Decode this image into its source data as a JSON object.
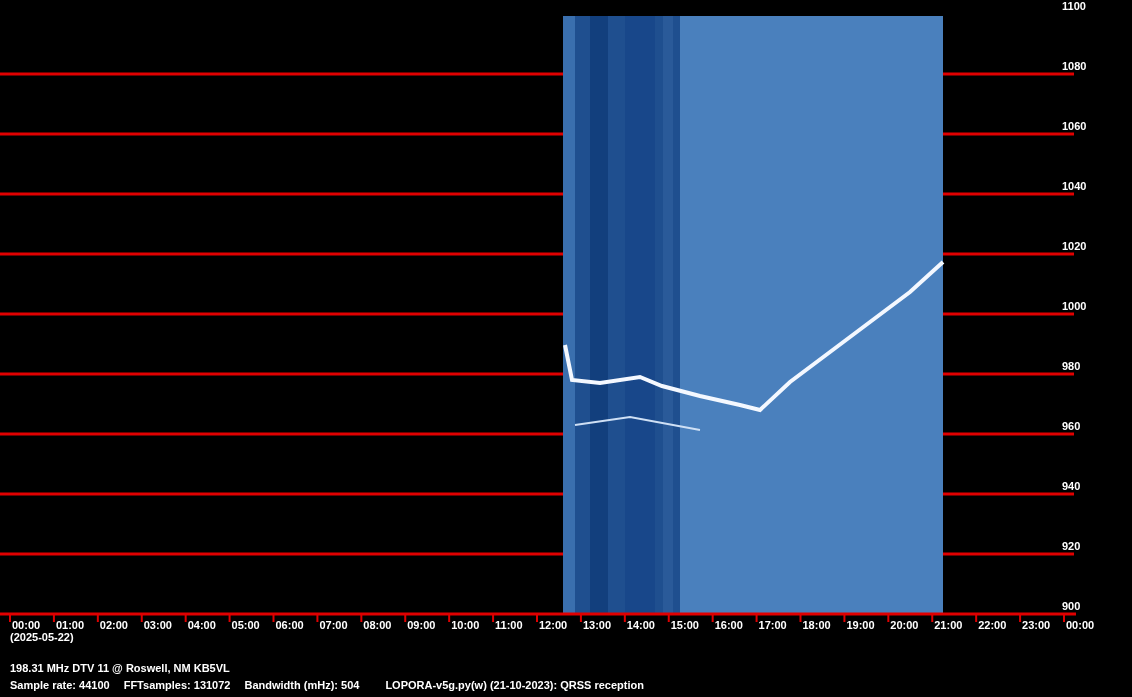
{
  "plot": {
    "y_axis_labels": [
      "1100",
      "1080",
      "1060",
      "1040",
      "1020",
      "1000",
      "980",
      "960",
      "940",
      "920",
      "900"
    ],
    "x_axis_labels": [
      "00:00",
      "01:00",
      "02:00",
      "03:00",
      "04:00",
      "05:00",
      "06:00",
      "07:00",
      "08:00",
      "09:00",
      "10:00",
      "11:00",
      "12:00",
      "13:00",
      "14:00",
      "15:00",
      "16:00",
      "17:00",
      "18:00",
      "19:00",
      "20:00",
      "21:00",
      "22:00",
      "23:00",
      "00:00"
    ],
    "date_label": "(2025-05-22)"
  },
  "footer": {
    "station": "198.31 MHz DTV 11 @ Roswell, NM KB5VL",
    "stats": [
      "Sample rate: 44100",
      "FFTsamples: 131072",
      "Bandwidth (mHz): 504"
    ],
    "program": "LOPORA-v5g.py(w) (21-10-2023): QRSS reception"
  }
}
